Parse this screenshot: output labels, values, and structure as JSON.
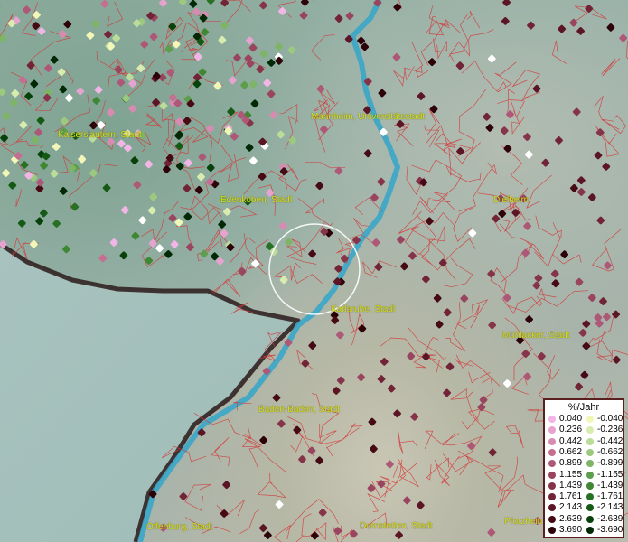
{
  "map": {
    "cities": [
      {
        "id": "kaiserslautern",
        "name": "Kaiserslautern, Stadt"
      },
      {
        "id": "mannheim",
        "name": "Mannheim, Universitätsstadt"
      },
      {
        "id": "edenkoben",
        "name": "Edenkoben, Stadt"
      },
      {
        "id": "dielheim",
        "name": "Dielheim"
      },
      {
        "id": "karlsruhe",
        "name": "Karlsruhe, Stadt"
      },
      {
        "id": "muehlacker",
        "name": "Mühlacker, Stadt"
      },
      {
        "id": "baden-baden",
        "name": "Baden-Baden, Stadt"
      },
      {
        "id": "offenburg",
        "name": "Offenburg, Stadt"
      },
      {
        "id": "dornstetten",
        "name": "Dornstetten, Stadt"
      },
      {
        "id": "pforzheim",
        "name": "Pforzhein"
      }
    ],
    "colors": {
      "river": "#3aa6c8",
      "boundary": "#d23a3a",
      "border": "#2a1a1a",
      "label": "#d8e11a"
    }
  },
  "legend": {
    "title": "%/Jahr",
    "positive": [
      {
        "value": "0.040",
        "color": "#f2b6e6"
      },
      {
        "value": "0.236",
        "color": "#e7a3cf"
      },
      {
        "value": "0.442",
        "color": "#d88bb0"
      },
      {
        "value": "0.662",
        "color": "#c46e92"
      },
      {
        "value": "0.899",
        "color": "#ad5877"
      },
      {
        "value": "1.155",
        "color": "#99455f"
      },
      {
        "value": "1.439",
        "color": "#86344a"
      },
      {
        "value": "1.761",
        "color": "#722437"
      },
      {
        "value": "2.143",
        "color": "#5c1525"
      },
      {
        "value": "2.639",
        "color": "#460a15"
      },
      {
        "value": "3.690",
        "color": "#2c0208"
      }
    ],
    "negative": [
      {
        "value": "-0.040",
        "color": "#f2f7b8"
      },
      {
        "value": "-0.236",
        "color": "#d8ecb0"
      },
      {
        "value": "-0.442",
        "color": "#bcdc9a"
      },
      {
        "value": "-0.662",
        "color": "#9dc97f"
      },
      {
        "value": "-0.899",
        "color": "#7db465"
      },
      {
        "value": "-1.155",
        "color": "#5c9e4b"
      },
      {
        "value": "-1.439",
        "color": "#408734"
      },
      {
        "value": "-1.761",
        "color": "#287023"
      },
      {
        "value": "-2.143",
        "color": "#145a15"
      },
      {
        "value": "-2.639",
        "color": "#07420a"
      },
      {
        "value": "-3.690",
        "color": "#022905"
      }
    ]
  }
}
